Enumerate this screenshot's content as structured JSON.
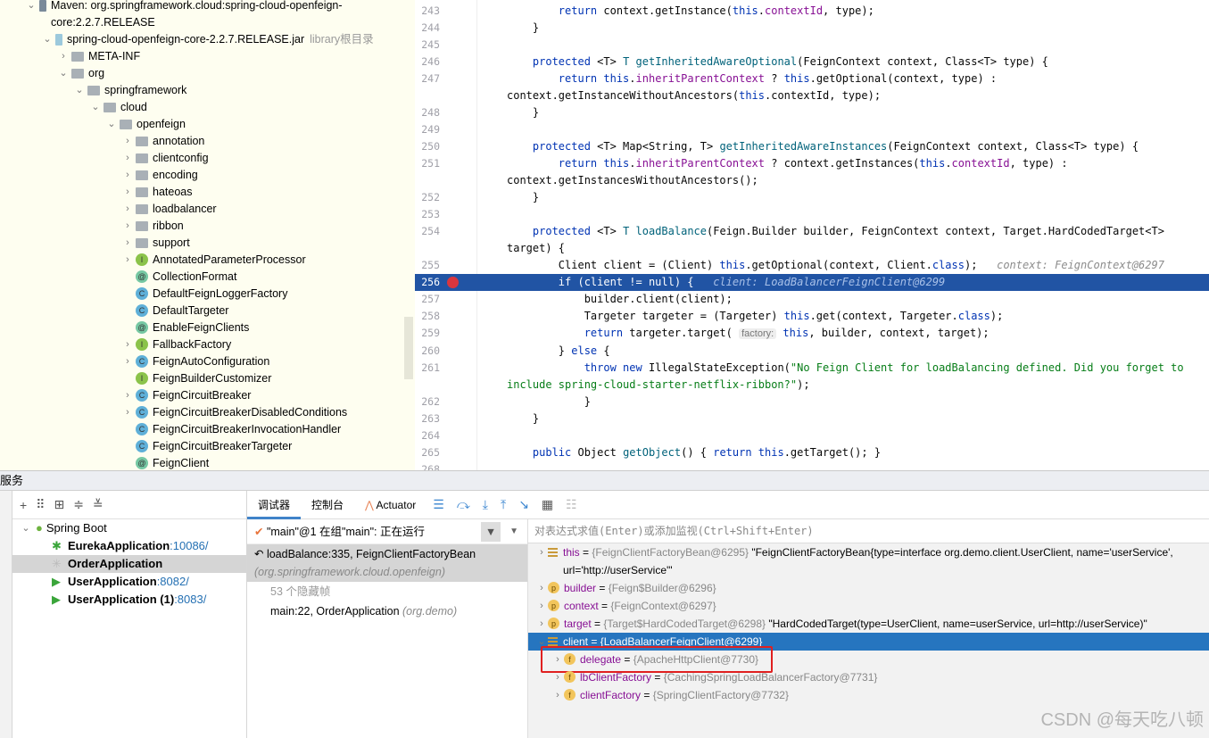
{
  "project_tree": {
    "items": [
      {
        "label": "Maven: org.springframework.cloud:spring-cloud-openfeign-core:2.2.7.RELEASE",
        "icon": "library-icon",
        "level": 0,
        "expanded": true
      },
      {
        "label": "spring-cloud-openfeign-core-2.2.7.RELEASE.jar",
        "hint": "library根目录",
        "icon": "jar-icon",
        "level": 1,
        "expanded": true
      },
      {
        "label": "META-INF",
        "icon": "folder-icon",
        "level": 2,
        "expanded": false
      },
      {
        "label": "org",
        "icon": "folder-icon",
        "level": 2,
        "expanded": true
      },
      {
        "label": "springframework",
        "icon": "folder-icon",
        "level": 3,
        "expanded": true
      },
      {
        "label": "cloud",
        "icon": "folder-icon",
        "level": 4,
        "expanded": true
      },
      {
        "label": "openfeign",
        "icon": "folder-icon",
        "level": 5,
        "expanded": true
      },
      {
        "label": "annotation",
        "icon": "folder-icon",
        "level": 6,
        "expanded": false
      },
      {
        "label": "clientconfig",
        "icon": "folder-icon",
        "level": 6,
        "expanded": false
      },
      {
        "label": "encoding",
        "icon": "folder-icon",
        "level": 6,
        "expanded": false
      },
      {
        "label": "hateoas",
        "icon": "folder-icon",
        "level": 6,
        "expanded": false
      },
      {
        "label": "loadbalancer",
        "icon": "folder-icon",
        "level": 6,
        "expanded": false
      },
      {
        "label": "ribbon",
        "icon": "folder-icon",
        "level": 6,
        "expanded": false
      },
      {
        "label": "support",
        "icon": "folder-icon",
        "level": 6,
        "expanded": false
      },
      {
        "label": "AnnotatedParameterProcessor",
        "icon": "interface-icon",
        "badge": "I",
        "level": 6,
        "expanded": false
      },
      {
        "label": "CollectionFormat",
        "icon": "annotation-icon",
        "badge": "@",
        "level": 6
      },
      {
        "label": "DefaultFeignLoggerFactory",
        "icon": "class-icon",
        "badge": "C",
        "level": 6
      },
      {
        "label": "DefaultTargeter",
        "icon": "class-icon",
        "badge": "C",
        "level": 6
      },
      {
        "label": "EnableFeignClients",
        "icon": "annotation-icon",
        "badge": "@",
        "level": 6
      },
      {
        "label": "FallbackFactory",
        "icon": "interface-icon",
        "badge": "I",
        "level": 6,
        "expanded": false
      },
      {
        "label": "FeignAutoConfiguration",
        "icon": "class-icon",
        "badge": "C",
        "level": 6,
        "expanded": false
      },
      {
        "label": "FeignBuilderCustomizer",
        "icon": "interface-icon",
        "badge": "I",
        "level": 6
      },
      {
        "label": "FeignCircuitBreaker",
        "icon": "class-icon",
        "badge": "C",
        "level": 6,
        "expanded": false
      },
      {
        "label": "FeignCircuitBreakerDisabledConditions",
        "icon": "class-icon",
        "badge": "C",
        "level": 6,
        "expanded": false
      },
      {
        "label": "FeignCircuitBreakerInvocationHandler",
        "icon": "class-icon",
        "badge": "C",
        "level": 6
      },
      {
        "label": "FeignCircuitBreakerTargeter",
        "icon": "class-icon",
        "badge": "C",
        "level": 6
      },
      {
        "label": "FeignClient",
        "icon": "annotation-icon",
        "badge": "@",
        "level": 6
      }
    ]
  },
  "editor": {
    "lines": [
      {
        "n": "243",
        "t": [
          [
            "        "
          ],
          [
            "return ",
            "kw"
          ],
          [
            "context.getInstance("
          ],
          [
            "this",
            "kw"
          ],
          [
            "."
          ],
          [
            "contextId",
            "fld"
          ],
          [
            ", type);"
          ]
        ]
      },
      {
        "n": "244",
        "t": [
          [
            "    }"
          ]
        ]
      },
      {
        "n": "245",
        "t": [
          [
            ""
          ]
        ]
      },
      {
        "n": "246",
        "t": [
          [
            "    "
          ],
          [
            "protected ",
            "kw"
          ],
          [
            "<T> "
          ],
          [
            "T ",
            "fn"
          ],
          [
            "getInheritedAwareOptional",
            "fn"
          ],
          [
            "(FeignContext context, Class<T> type) {"
          ]
        ]
      },
      {
        "n": "247",
        "t": [
          [
            "        "
          ],
          [
            "return this",
            "kw"
          ],
          [
            "."
          ],
          [
            "inheritParentContext",
            "fld"
          ],
          [
            " ? "
          ],
          [
            "this",
            "kw"
          ],
          [
            ".getOptional(context, type) : context.getInstanceWithoutAncestors("
          ],
          [
            "this",
            "kw"
          ],
          [
            ".contextId, type);"
          ]
        ]
      },
      {
        "n": "248",
        "t": [
          [
            "    }"
          ]
        ]
      },
      {
        "n": "249",
        "t": [
          [
            ""
          ]
        ]
      },
      {
        "n": "250",
        "t": [
          [
            "    "
          ],
          [
            "protected ",
            "kw"
          ],
          [
            "<T> Map<String, T> "
          ],
          [
            "getInheritedAwareInstances",
            "fn"
          ],
          [
            "(FeignContext context, Class<T> type) {"
          ]
        ]
      },
      {
        "n": "251",
        "t": [
          [
            "        "
          ],
          [
            "return this",
            "kw"
          ],
          [
            "."
          ],
          [
            "inheritParentContext",
            "fld"
          ],
          [
            " ? context.getInstances("
          ],
          [
            "this",
            "kw"
          ],
          [
            "."
          ],
          [
            "contextId",
            "fld"
          ],
          [
            ", type) : context.getInstancesWithoutAncestors();"
          ]
        ]
      },
      {
        "n": "252",
        "t": [
          [
            "    }"
          ]
        ]
      },
      {
        "n": "253",
        "t": [
          [
            ""
          ]
        ]
      },
      {
        "n": "254",
        "t": [
          [
            "    "
          ],
          [
            "protected ",
            "kw"
          ],
          [
            "<T> "
          ],
          [
            "T ",
            "fn"
          ],
          [
            "loadBalance",
            "fn"
          ],
          [
            "(Feign.Builder builder, FeignContext context, Target.HardCodedTarget<T> target) {"
          ]
        ]
      },
      {
        "n": "255",
        "t": [
          [
            "        Client client = (Client) "
          ],
          [
            "this",
            "kw"
          ],
          [
            ".getOptional(context, Client."
          ],
          [
            "class",
            "kw"
          ],
          [
            ");   "
          ],
          [
            "context: FeignContext@6297",
            "inl"
          ]
        ]
      },
      {
        "n": "256",
        "cur": true,
        "bp": true,
        "t": [
          [
            "        if (client != null) {   "
          ],
          [
            "client: LoadBalancerFeignClient@6299",
            "inl"
          ]
        ]
      },
      {
        "n": "257",
        "t": [
          [
            "            builder.client(client);"
          ]
        ]
      },
      {
        "n": "258",
        "t": [
          [
            "            Targeter targeter = (Targeter) "
          ],
          [
            "this",
            "kw"
          ],
          [
            ".get(context, Targeter."
          ],
          [
            "class",
            "kw"
          ],
          [
            ");"
          ]
        ]
      },
      {
        "n": "259",
        "t": [
          [
            "            "
          ],
          [
            "return ",
            "kw"
          ],
          [
            "targeter.target( "
          ],
          [
            "factory:",
            "ph"
          ],
          [
            " "
          ],
          [
            "this",
            "kw"
          ],
          [
            ", builder, context, target);"
          ]
        ]
      },
      {
        "n": "260",
        "t": [
          [
            "        } "
          ],
          [
            "else ",
            "kw"
          ],
          [
            "{"
          ]
        ]
      },
      {
        "n": "261",
        "t": [
          [
            "            "
          ],
          [
            "throw new ",
            "kw"
          ],
          [
            "IllegalStateException("
          ],
          [
            "\"No Feign Client for loadBalancing defined. Did you forget to include spring-cloud-starter-netflix-ribbon?\"",
            "str"
          ],
          [
            ");"
          ]
        ]
      },
      {
        "n": "262",
        "t": [
          [
            "            }"
          ]
        ]
      },
      {
        "n": "263",
        "t": [
          [
            "    }"
          ]
        ]
      },
      {
        "n": "264",
        "t": [
          [
            ""
          ]
        ]
      },
      {
        "n": "265",
        "t": [
          [
            "    "
          ],
          [
            "public ",
            "kw"
          ],
          [
            "Object "
          ],
          [
            "getObject",
            "fn"
          ],
          [
            "() { "
          ],
          [
            "return this",
            "kw"
          ],
          [
            ".getTarget(); }"
          ]
        ]
      },
      {
        "n": "268",
        "t": [
          [
            ""
          ]
        ]
      }
    ]
  },
  "services": {
    "header": "服务",
    "toolbar": [
      "add-icon",
      "group-icon",
      "filter-add-icon",
      "expand-all-icon",
      "collapse-all-icon"
    ],
    "group": "Spring Boot",
    "items": [
      {
        "name": "EurekaApplication",
        "port": ":10086/",
        "icon": "bug-icon"
      },
      {
        "name": "OrderApplication",
        "port": "",
        "icon": "loading-icon",
        "selected": true
      },
      {
        "name": "UserApplication",
        "port": ":8082/",
        "icon": "run-icon"
      },
      {
        "name": "UserApplication (1)",
        "port": ":8083/",
        "icon": "run-icon"
      }
    ]
  },
  "debugger": {
    "tabs": [
      {
        "label": "调试器",
        "active": true
      },
      {
        "label": "控制台"
      },
      {
        "label": "Actuator"
      }
    ],
    "thread": "\"main\"@1 在组\"main\": 正在运行",
    "frames": [
      {
        "method": "loadBalance:335, FeignClientFactoryBean",
        "pkg": "(org.springframework.cloud.openfeign)",
        "selected": true
      },
      {
        "method": "53 个隐藏帧",
        "pkg": "",
        "hidden": true
      },
      {
        "method": "main:22, OrderApplication",
        "pkg": "(org.demo)"
      }
    ],
    "eval_placeholder": "对表达式求值(Enter)或添加监视(Ctrl+Shift+Enter)",
    "variables": [
      {
        "name": "this",
        "type": "{FeignClientFactoryBean@6295}",
        "value": "\"FeignClientFactoryBean{type=interface org.demo.client.UserClient, name='userService', url='http://userService'\"",
        "badge": "list",
        "level": 0
      },
      {
        "name": "builder",
        "type": "{Feign$Builder@6296}",
        "badge": "p",
        "level": 0
      },
      {
        "name": "context",
        "type": "{FeignContext@6297}",
        "badge": "p",
        "level": 0
      },
      {
        "name": "target",
        "type": "{Target$HardCodedTarget@6298}",
        "value": "\"HardCodedTarget(type=UserClient, name=userService, url=http://userService)\"",
        "badge": "p",
        "level": 0
      },
      {
        "name": "client",
        "type": "{LoadBalancerFeignClient@6299}",
        "badge": "list",
        "level": 0,
        "selected": true,
        "expanded": true
      },
      {
        "name": "delegate",
        "type": "{ApacheHttpClient@7730}",
        "badge": "f",
        "level": 1,
        "highlighted": true
      },
      {
        "name": "lbClientFactory",
        "type": "{CachingSpringLoadBalancerFactory@7731}",
        "badge": "f",
        "level": 1
      },
      {
        "name": "clientFactory",
        "type": "{SpringClientFactory@7732}",
        "badge": "f",
        "level": 1
      }
    ]
  },
  "watermark": "CSDN @每天吃八顿",
  "colors": {
    "selection": "#2154a4",
    "var_selection": "#2675bf",
    "highlight_box": "#e02020"
  }
}
